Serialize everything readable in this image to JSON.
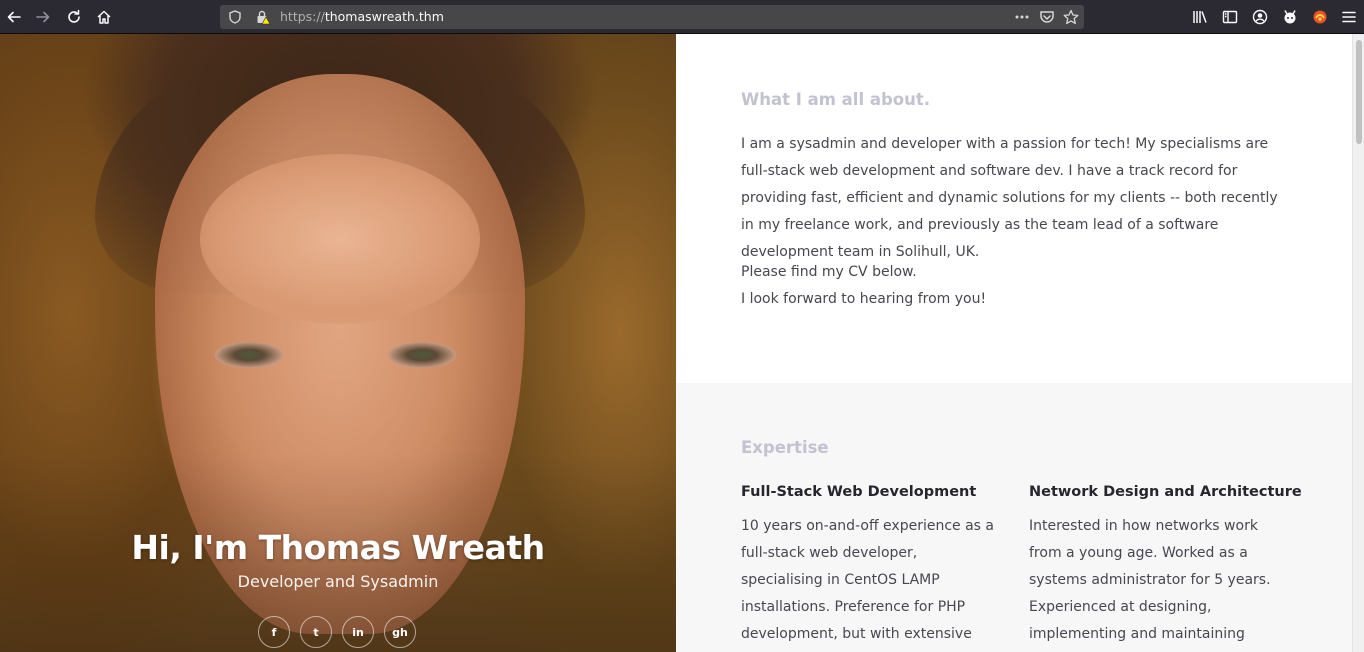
{
  "browser": {
    "url_scheme": "https://",
    "url_host": "thomaswreath.thm",
    "icons": {
      "back": "back-arrow-icon",
      "forward": "forward-arrow-icon",
      "reload": "reload-icon",
      "home": "home-icon",
      "tracking": "shield-icon",
      "insecure": "insecure-lock-icon",
      "more": "page-actions-icon",
      "pocket": "pocket-icon",
      "bookmark": "star-icon",
      "library": "library-icon",
      "sidebar": "sidebar-icon",
      "account": "account-icon",
      "ext1": "extension-icon",
      "ext2": "extension-icon",
      "menu": "hamburger-menu-icon"
    }
  },
  "hero": {
    "title": "Hi, I'm Thomas Wreath",
    "subtitle": "Developer and Sysadmin",
    "socials": [
      {
        "name": "facebook",
        "glyph": "f"
      },
      {
        "name": "twitter",
        "glyph": "t"
      },
      {
        "name": "linkedin",
        "glyph": "in"
      },
      {
        "name": "github",
        "glyph": "gh"
      }
    ]
  },
  "about": {
    "title": "What I am all about.",
    "intro": "I am a sysadmin and developer with a passion for tech! My specialisms are full-stack web development and software dev. I have a track record for providing fast, efficient and dynamic solutions for my clients -- both recently in my freelance work, and previously as the team lead of a software development team in Solihull, UK.",
    "cv_line": "Please find my CV below.",
    "closing_line": "I look forward to hearing from you!"
  },
  "expertise": {
    "title": "Expertise",
    "items": [
      {
        "title": "Full-Stack Web Development",
        "text": "10 years on-and-off experience as a full-stack web developer, specialising in CentOS LAMP installations. Preference for PHP development, but with extensive knowledge of full-stack"
      },
      {
        "title": "Network Design and Architecture",
        "text": "Interested in how networks work from a young age. Worked as a systems administrator for 5 years. Experienced at designing, implementing and maintaining networks comprised of"
      }
    ]
  }
}
